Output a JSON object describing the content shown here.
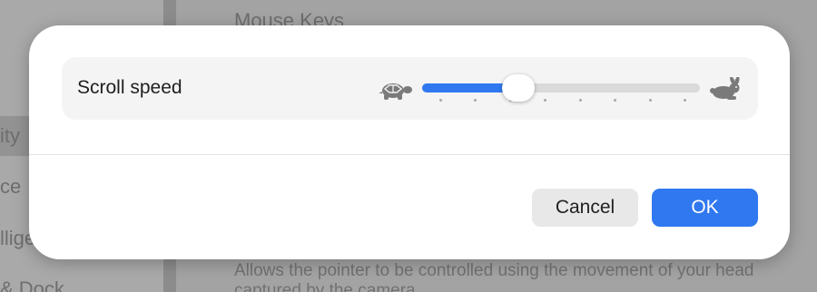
{
  "background_window": {
    "heading": "Mouse Keys",
    "sidebar_items": [
      {
        "label": "ity",
        "selected": true
      },
      {
        "label": "ce",
        "selected": false
      },
      {
        "label": "llige",
        "selected": false
      },
      {
        "label": "& Dock",
        "selected": false
      }
    ],
    "description_line1": "Allows the pointer to be controlled using the movement of your head",
    "description_line2": "captured by the camera."
  },
  "dialog": {
    "setting": {
      "label": "Scroll speed",
      "slow_icon": "turtle-icon",
      "fast_icon": "rabbit-icon",
      "slider": {
        "value_fraction": 0.31,
        "tick_count": 8
      }
    },
    "buttons": {
      "cancel_label": "Cancel",
      "ok_label": "OK"
    }
  },
  "colors": {
    "accent": "#2f78f0",
    "track": "#dadada",
    "dialog_background": "#ffffff",
    "row_background": "#f4f4f4"
  }
}
